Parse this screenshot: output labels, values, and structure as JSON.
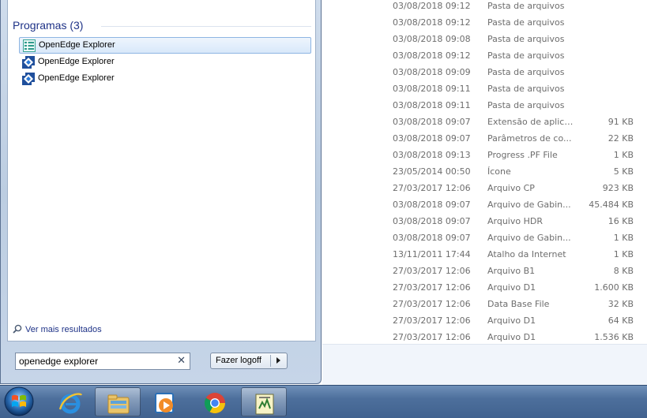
{
  "explorer": {
    "rows": [
      {
        "date": "03/08/2018 09:12",
        "type": "Pasta de arquivos",
        "size": ""
      },
      {
        "date": "03/08/2018 09:12",
        "type": "Pasta de arquivos",
        "size": ""
      },
      {
        "date": "03/08/2018 09:08",
        "type": "Pasta de arquivos",
        "size": ""
      },
      {
        "date": "03/08/2018 09:12",
        "type": "Pasta de arquivos",
        "size": ""
      },
      {
        "date": "03/08/2018 09:09",
        "type": "Pasta de arquivos",
        "size": ""
      },
      {
        "date": "03/08/2018 09:11",
        "type": "Pasta de arquivos",
        "size": ""
      },
      {
        "date": "03/08/2018 09:11",
        "type": "Pasta de arquivos",
        "size": ""
      },
      {
        "date": "03/08/2018 09:07",
        "type": "Extensão de aplica...",
        "size": "91 KB"
      },
      {
        "date": "03/08/2018 09:07",
        "type": "Parâmetros de co...",
        "size": "22 KB"
      },
      {
        "date": "03/08/2018 09:13",
        "type": "Progress .PF File",
        "size": "1 KB"
      },
      {
        "date": "23/05/2014 00:50",
        "type": "Ícone",
        "size": "5 KB"
      },
      {
        "date": "27/03/2017 12:06",
        "type": "Arquivo CP",
        "size": "923 KB"
      },
      {
        "date": "03/08/2018 09:07",
        "type": "Arquivo de Gabin...",
        "size": "45.484 KB"
      },
      {
        "date": "03/08/2018 09:07",
        "type": "Arquivo HDR",
        "size": "16 KB"
      },
      {
        "date": "03/08/2018 09:07",
        "type": "Arquivo de Gabin...",
        "size": "1 KB"
      },
      {
        "date": "13/11/2011 17:44",
        "type": "Atalho da Internet",
        "size": "1 KB"
      },
      {
        "date": "27/03/2017 12:06",
        "type": "Arquivo B1",
        "size": "8 KB"
      },
      {
        "date": "27/03/2017 12:06",
        "type": "Arquivo D1",
        "size": "1.600 KB"
      },
      {
        "date": "27/03/2017 12:06",
        "type": "Data Base File",
        "size": "32 KB"
      },
      {
        "date": "27/03/2017 12:06",
        "type": "Arquivo D1",
        "size": "64 KB"
      },
      {
        "date": "27/03/2017 12:06",
        "type": "Arquivo D1",
        "size": "1.536 KB"
      }
    ]
  },
  "start_menu": {
    "programs_header": "Programas (3)",
    "programs": [
      {
        "label": "OpenEdge Explorer",
        "icon": "openedge-explorer-icon",
        "selected": true
      },
      {
        "label": "OpenEdge Explorer",
        "icon": "openedge-blue-icon",
        "selected": false
      },
      {
        "label": "OpenEdge Explorer",
        "icon": "openedge-blue-icon",
        "selected": false
      }
    ],
    "see_more": "Ver mais resultados",
    "search_value": "openedge explorer",
    "logoff_label": "Fazer logoff"
  },
  "taskbar": {
    "items": [
      {
        "icon": "internet-explorer-icon"
      },
      {
        "icon": "windows-explorer-icon",
        "active": true
      },
      {
        "icon": "media-player-icon"
      },
      {
        "icon": "chrome-icon"
      },
      {
        "icon": "notepad-editor-icon",
        "active": true
      }
    ]
  },
  "colors": {
    "header_text": "#1e3287",
    "selection_border": "#8eb5e2",
    "taskbar": "#4d6f9c"
  }
}
